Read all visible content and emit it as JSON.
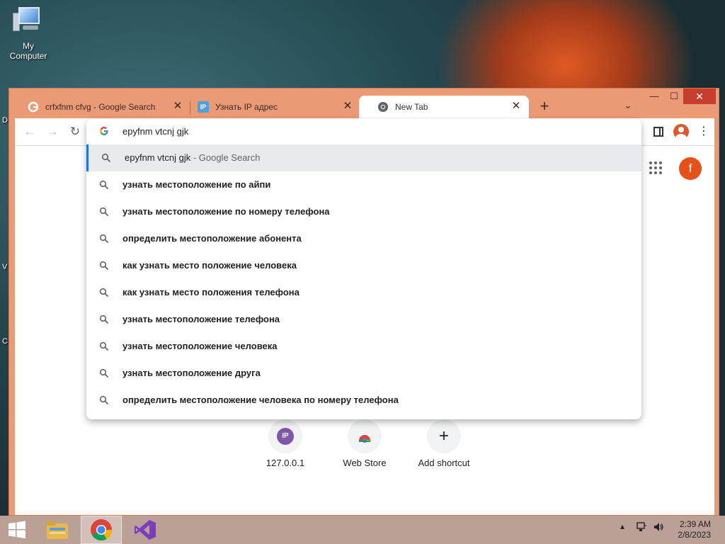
{
  "desktop": {
    "icon_label": "My Computer",
    "side_letters": [
      "D",
      "V",
      "C"
    ]
  },
  "browser": {
    "tabs": [
      {
        "title": "crfxfnm cfvg - Google Search",
        "favicon": "google-g-icon"
      },
      {
        "title": "Узнать IP адрес",
        "favicon": "ip-icon",
        "favicon_text": "IP"
      },
      {
        "title": "New Tab",
        "favicon": "chrome-icon"
      }
    ],
    "new_tab_symbol": "+",
    "tab_search_symbol": "⌄",
    "window_controls": {
      "minimize": "—",
      "maximize": "☐",
      "close": "✕"
    }
  },
  "omnibox": {
    "query": "epyfnm vtcnj gjk",
    "suggestions": [
      {
        "text": "epyfnm vtcnj gjk",
        "hint": " - Google Search",
        "selected": true
      },
      {
        "text": "узнать местоположение по айпи"
      },
      {
        "text": "узнать местоположение по номеру телефона"
      },
      {
        "text": "определить местоположение абонента"
      },
      {
        "text": "как узнать место положение человека"
      },
      {
        "text": "как узнать место положения телефона"
      },
      {
        "text": "узнать местоположение телефона"
      },
      {
        "text": "узнать местоположение человека"
      },
      {
        "text": "узнать местоположение друга"
      },
      {
        "text": "определить местоположение человека по номеру телефона"
      }
    ]
  },
  "new_tab_page": {
    "avatar_letter": "f",
    "shortcuts": [
      {
        "label": "127.0.0.1",
        "icon": "ip-icon",
        "icon_text": "IP"
      },
      {
        "label": "Web Store",
        "icon": "chrome-webstore-icon"
      },
      {
        "label": "Add shortcut",
        "icon": "plus-icon",
        "icon_text": "+"
      }
    ]
  },
  "taskbar": {
    "time": "2:39 AM",
    "date": "2/8/2023"
  },
  "colors": {
    "window_frame": "#eb9a76",
    "close_button": "#c73c2c",
    "selected_row": "#e8eaed",
    "accent_blue": "#1a73e8",
    "avatar": "#e8501a"
  }
}
